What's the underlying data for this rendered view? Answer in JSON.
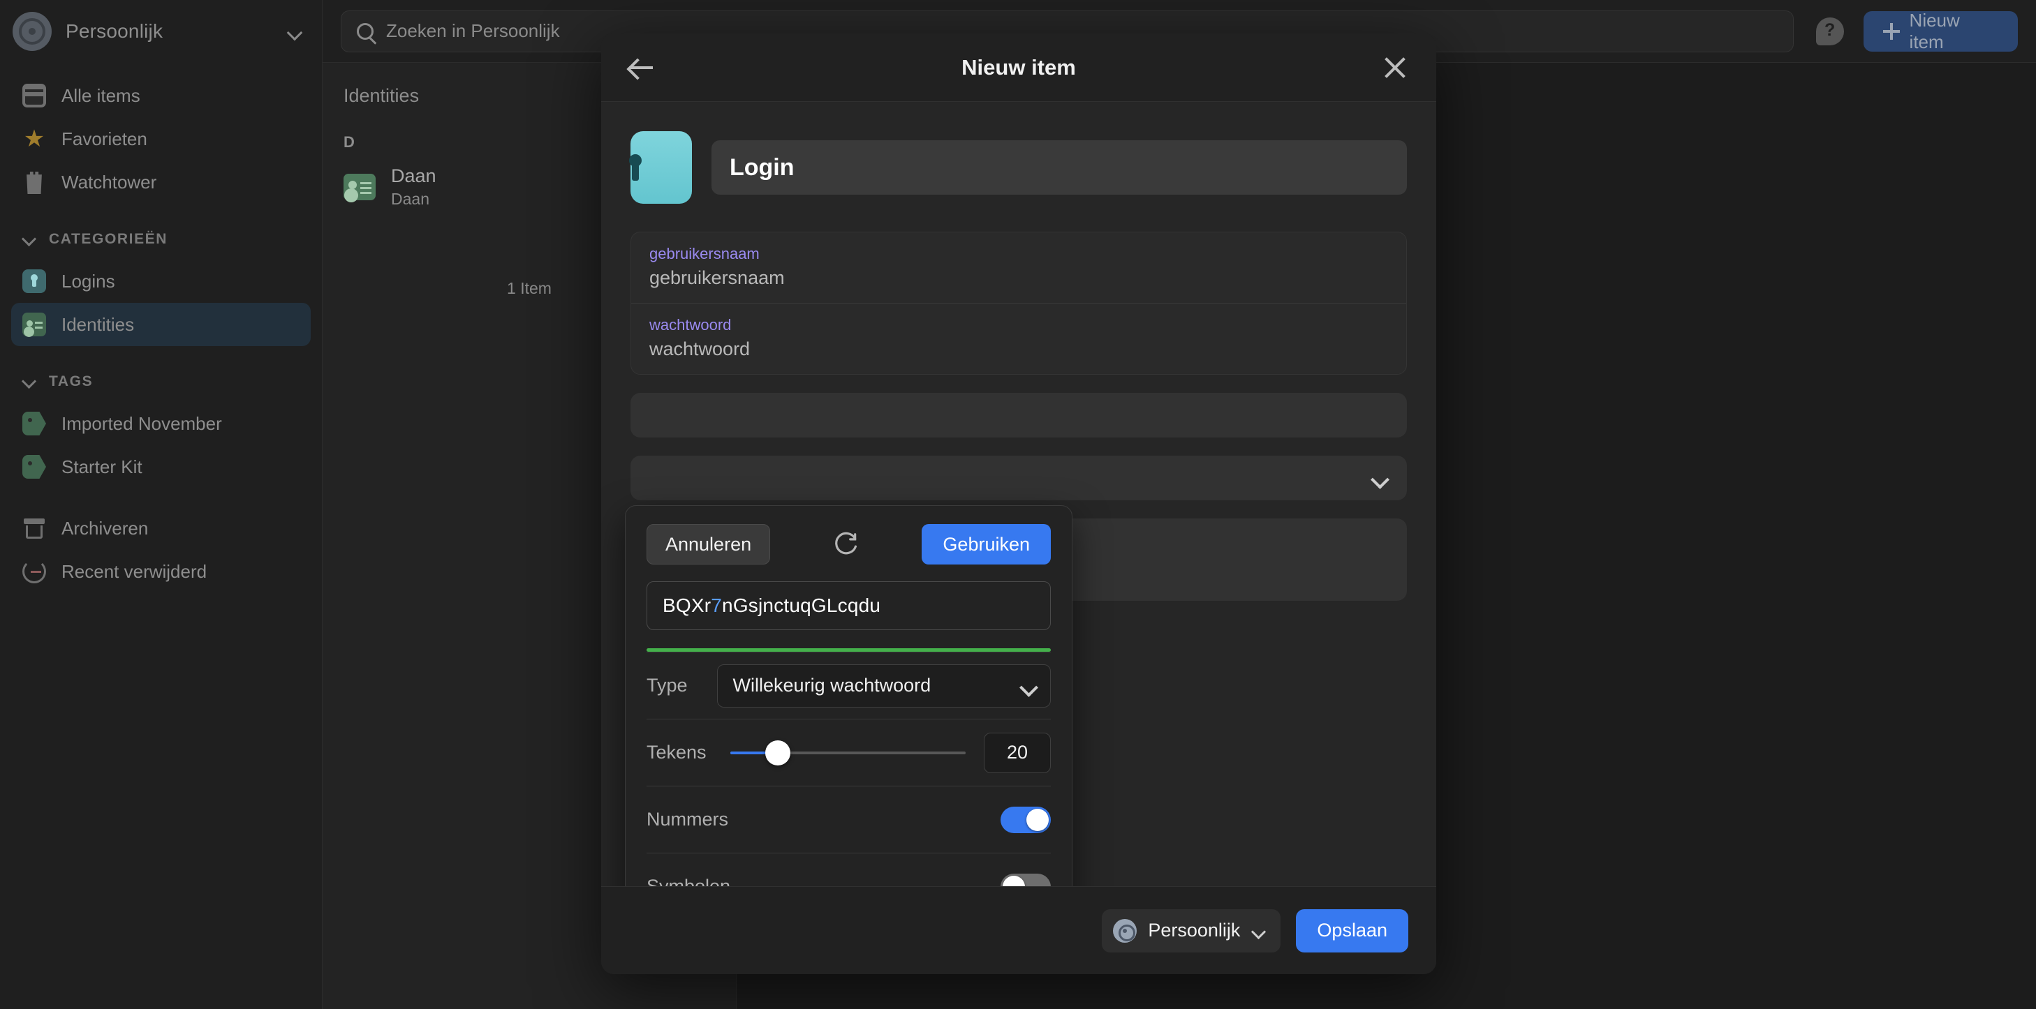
{
  "sidebar": {
    "vault": {
      "name": "Persoonlijk",
      "icon": "vault-icon",
      "chevron": "chevron-down-icon"
    },
    "top_items": [
      {
        "label": "Alle items",
        "icon": "all-items-icon"
      },
      {
        "label": "Favorieten",
        "icon": "star-icon"
      },
      {
        "label": "Watchtower",
        "icon": "watchtower-icon"
      }
    ],
    "categories_header": "CATEGORIEËN",
    "categories": [
      {
        "label": "Logins",
        "icon": "login-icon",
        "selected": false
      },
      {
        "label": "Identities",
        "icon": "identity-icon",
        "selected": true
      }
    ],
    "tags_header": "TAGS",
    "tags": [
      {
        "label": "Imported November",
        "icon": "tag-icon"
      },
      {
        "label": "Starter Kit",
        "icon": "tag-icon"
      }
    ],
    "bottom_items": [
      {
        "label": "Archiveren",
        "icon": "archive-icon"
      },
      {
        "label": "Recent verwijderd",
        "icon": "trash-restore-icon"
      }
    ]
  },
  "topbar": {
    "search_placeholder": "Zoeken in Persoonlijk",
    "search_value": "",
    "help_label": "?",
    "new_item_label": "Nieuw item"
  },
  "list": {
    "title": "Identities",
    "section_letter": "D",
    "rows": [
      {
        "title": "Daan",
        "subtitle": "Daan",
        "icon": "identity-card-icon"
      }
    ],
    "count_label": "1 Item"
  },
  "modal": {
    "title": "Nieuw item",
    "back_icon": "back-arrow-icon",
    "close_icon": "close-icon",
    "item_icon": "login-keyhole-icon",
    "item_title": "Login",
    "fields": [
      {
        "label": "gebruikersnaam",
        "value": "gebruikersnaam"
      },
      {
        "label": "wachtwoord",
        "value": "wachtwoord"
      }
    ],
    "footer": {
      "vault_label": "Persoonlijk",
      "vault_icon": "vault-icon",
      "vault_chevron": "chevron-down-icon",
      "save_label": "Opslaan"
    }
  },
  "generator": {
    "cancel_label": "Annuleren",
    "regenerate_icon": "refresh-icon",
    "use_label": "Gebruiken",
    "password_prefix": "BQXr",
    "password_digit": "7",
    "password_suffix": "nGsjnctuqGLcqdu",
    "strength_color": "#44b14b",
    "type_label": "Type",
    "type_value": "Willekeurig wachtwoord",
    "length_label": "Tekens",
    "length_value": "20",
    "numbers_label": "Nummers",
    "numbers_on": true,
    "symbols_label": "Symbolen",
    "symbols_on": false
  },
  "colors": {
    "accent_blue": "#3779f0",
    "label_purple": "#9a8af0",
    "strength_green": "#44b14b",
    "selected_sidebar": "#22303c"
  }
}
